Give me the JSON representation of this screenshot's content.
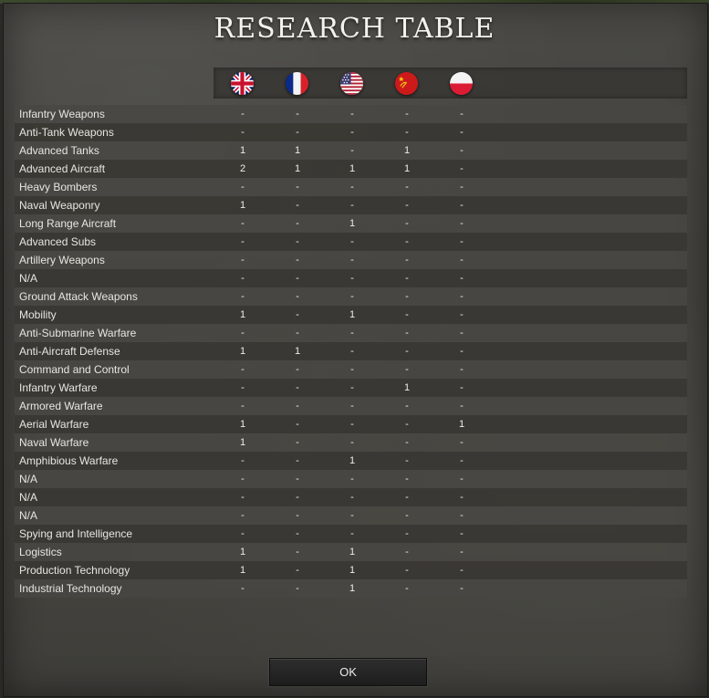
{
  "title": "RESEARCH TABLE",
  "flags": [
    {
      "country": "United Kingdom",
      "icon": "uk-flag-icon"
    },
    {
      "country": "France",
      "icon": "france-flag-icon"
    },
    {
      "country": "United States",
      "icon": "usa-flag-icon"
    },
    {
      "country": "Soviet Union",
      "icon": "ussr-flag-icon"
    },
    {
      "country": "Poland",
      "icon": "poland-flag-icon"
    }
  ],
  "rows": [
    {
      "name": "Infantry Weapons",
      "values": [
        "-",
        "-",
        "-",
        "-",
        "-"
      ]
    },
    {
      "name": "Anti-Tank Weapons",
      "values": [
        "-",
        "-",
        "-",
        "-",
        "-"
      ]
    },
    {
      "name": "Advanced Tanks",
      "values": [
        "1",
        "1",
        "-",
        "1",
        "-"
      ]
    },
    {
      "name": "Advanced Aircraft",
      "values": [
        "2",
        "1",
        "1",
        "1",
        "-"
      ]
    },
    {
      "name": "Heavy Bombers",
      "values": [
        "-",
        "-",
        "-",
        "-",
        "-"
      ]
    },
    {
      "name": "Naval Weaponry",
      "values": [
        "1",
        "-",
        "-",
        "-",
        "-"
      ]
    },
    {
      "name": "Long Range Aircraft",
      "values": [
        "-",
        "-",
        "1",
        "-",
        "-"
      ]
    },
    {
      "name": "Advanced Subs",
      "values": [
        "-",
        "-",
        "-",
        "-",
        "-"
      ]
    },
    {
      "name": "Artillery Weapons",
      "values": [
        "-",
        "-",
        "-",
        "-",
        "-"
      ]
    },
    {
      "name": "N/A",
      "values": [
        "-",
        "-",
        "-",
        "-",
        "-"
      ]
    },
    {
      "name": "Ground Attack Weapons",
      "values": [
        "-",
        "-",
        "-",
        "-",
        "-"
      ]
    },
    {
      "name": "Mobility",
      "values": [
        "1",
        "-",
        "1",
        "-",
        "-"
      ]
    },
    {
      "name": "Anti-Submarine Warfare",
      "values": [
        "-",
        "-",
        "-",
        "-",
        "-"
      ]
    },
    {
      "name": "Anti-Aircraft Defense",
      "values": [
        "1",
        "1",
        "-",
        "-",
        "-"
      ]
    },
    {
      "name": "Command and Control",
      "values": [
        "-",
        "-",
        "-",
        "-",
        "-"
      ]
    },
    {
      "name": "Infantry Warfare",
      "values": [
        "-",
        "-",
        "-",
        "1",
        "-"
      ]
    },
    {
      "name": "Armored Warfare",
      "values": [
        "-",
        "-",
        "-",
        "-",
        "-"
      ]
    },
    {
      "name": "Aerial Warfare",
      "values": [
        "1",
        "-",
        "-",
        "-",
        "1"
      ]
    },
    {
      "name": "Naval Warfare",
      "values": [
        "1",
        "-",
        "-",
        "-",
        "-"
      ]
    },
    {
      "name": "Amphibious Warfare",
      "values": [
        "-",
        "-",
        "1",
        "-",
        "-"
      ]
    },
    {
      "name": "N/A",
      "values": [
        "-",
        "-",
        "-",
        "-",
        "-"
      ]
    },
    {
      "name": "N/A",
      "values": [
        "-",
        "-",
        "-",
        "-",
        "-"
      ]
    },
    {
      "name": "N/A",
      "values": [
        "-",
        "-",
        "-",
        "-",
        "-"
      ]
    },
    {
      "name": "Spying and Intelligence",
      "values": [
        "-",
        "-",
        "-",
        "-",
        "-"
      ]
    },
    {
      "name": "Logistics",
      "values": [
        "1",
        "-",
        "1",
        "-",
        "-"
      ]
    },
    {
      "name": "Production Technology",
      "values": [
        "1",
        "-",
        "1",
        "-",
        "-"
      ]
    },
    {
      "name": "Industrial Technology",
      "values": [
        "-",
        "-",
        "1",
        "-",
        "-"
      ]
    }
  ],
  "ok_label": "OK"
}
